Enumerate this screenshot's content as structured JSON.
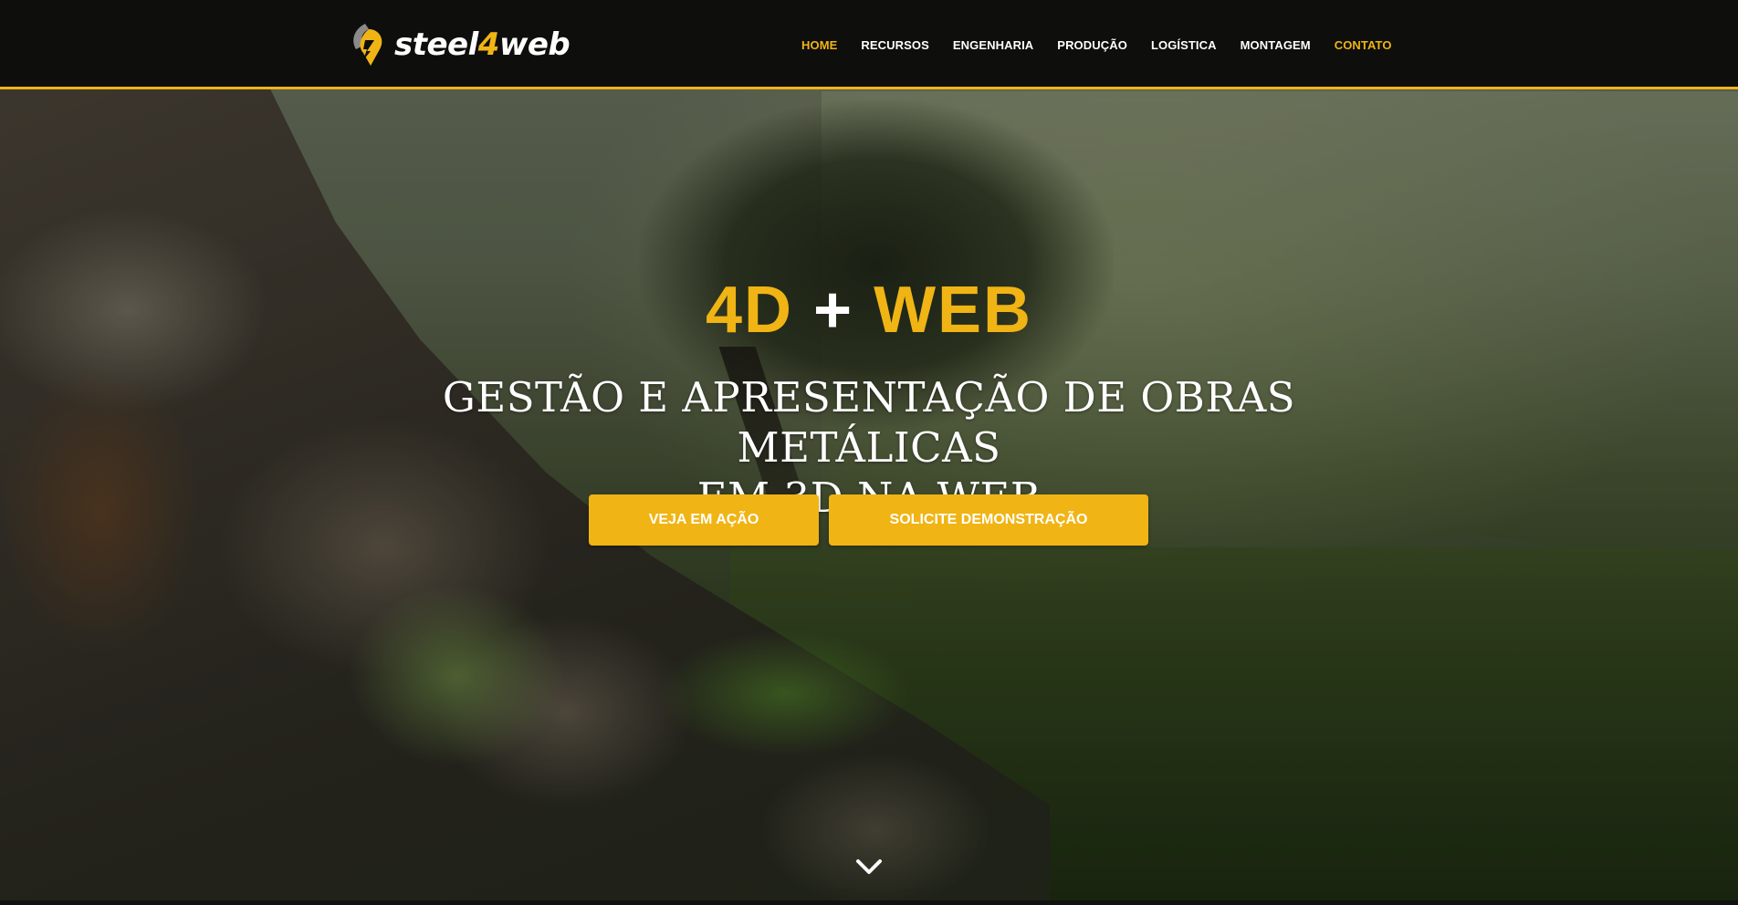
{
  "brand": {
    "logo_prefix": "steel",
    "logo_four": "4",
    "logo_suffix": "web",
    "accent_color": "#f0b414",
    "header_color": "#0e0e0d"
  },
  "nav": {
    "items": [
      {
        "label": "HOME",
        "active": true
      },
      {
        "label": "RECURSOS"
      },
      {
        "label": "ENGENHARIA"
      },
      {
        "label": "PRODUÇÃO"
      },
      {
        "label": "LOGÍSTICA"
      },
      {
        "label": "MONTAGEM"
      },
      {
        "label": "CONTATO",
        "highlight": true
      }
    ]
  },
  "hero": {
    "headline_part1": "4D",
    "headline_plus": "+",
    "headline_part2": "WEB",
    "subtitle_line1": "GESTÃO E APRESENTAÇÃO DE OBRAS METÁLICAS",
    "subtitle_line2": "EM 3D NA WEB",
    "button_watch": "VEJA EM AÇÃO",
    "button_demo": "SOLICITE DEMONSTRAÇÃO",
    "scroll_icon": "chevron-down-icon"
  }
}
